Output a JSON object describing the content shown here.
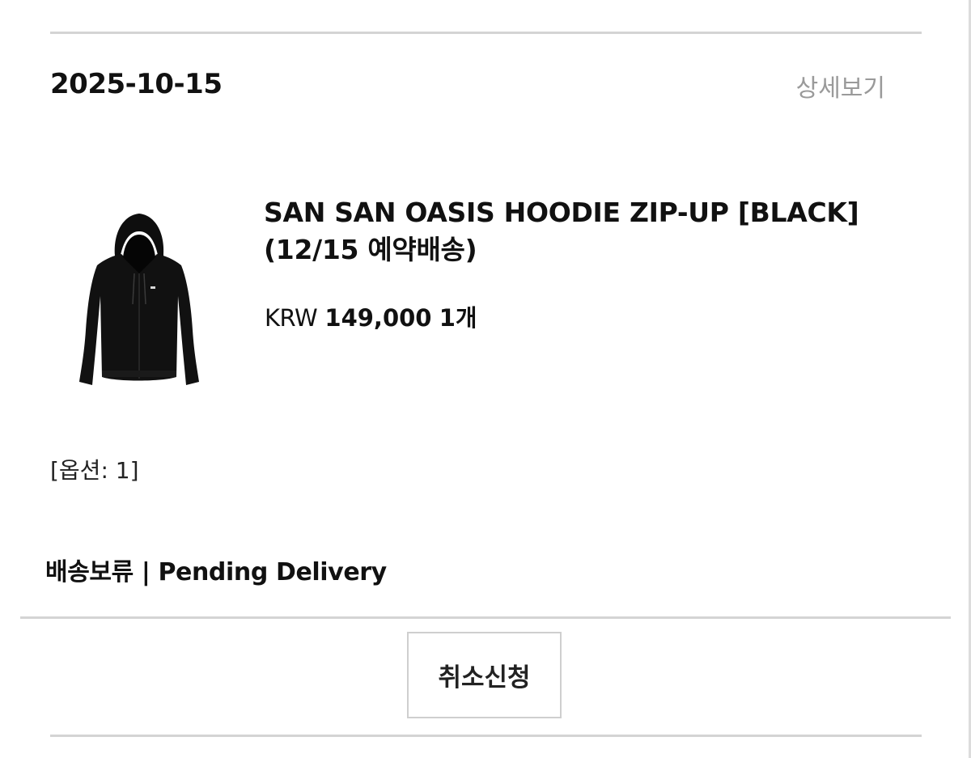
{
  "order": {
    "date": "2025-10-15",
    "detail_link": "상세보기"
  },
  "product": {
    "image_icon": "black-hoodie-zip-up",
    "name_line1": "SAN SAN OASIS HOODIE ZIP-UP [BLACK]",
    "name_line2": "(12/15 예약배송)",
    "currency": "KRW",
    "price": "149,000",
    "quantity": "1개"
  },
  "option": "[옵션: 1]",
  "status": "배송보류 | Pending Delivery",
  "actions": {
    "cancel_label": "취소신청"
  },
  "colors": {
    "text": "#111111",
    "muted": "#9a9a9a",
    "divider": "#d4d4d4",
    "button_border": "#cfcfcf"
  }
}
